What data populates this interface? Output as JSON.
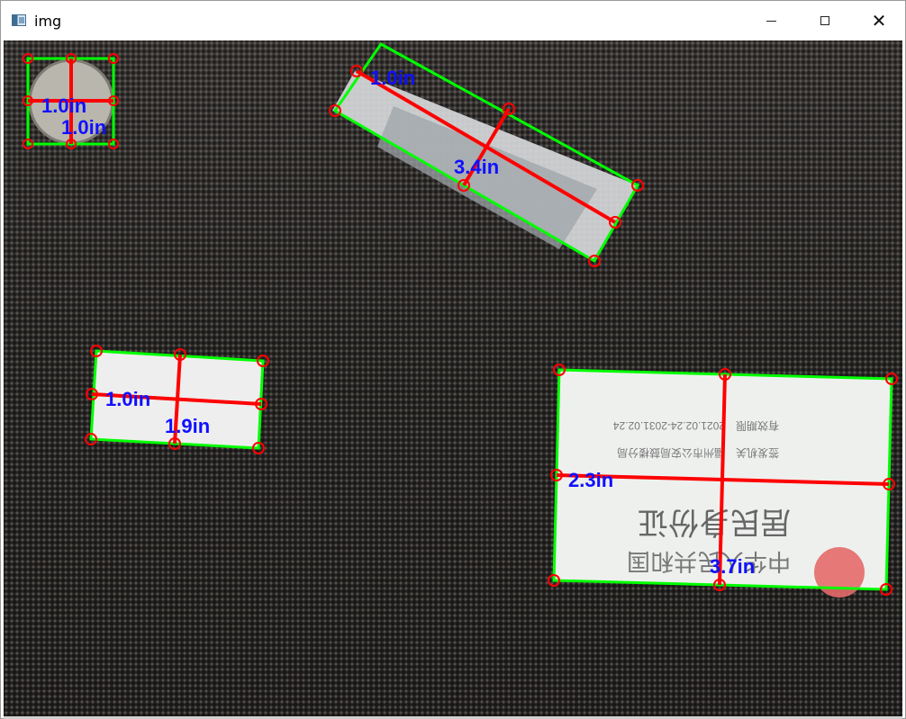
{
  "window": {
    "title": "img",
    "icon": "opencv-image-window-icon",
    "controls": {
      "minimize": "minimize-icon",
      "maximize": "maximize-icon",
      "close": "close-icon"
    }
  },
  "measurements": {
    "coin": {
      "label_a": "1.0in",
      "label_b": "1.0in"
    },
    "tube": {
      "label_a": "1.0in",
      "label_b": "3.4in"
    },
    "card": {
      "label_a": "1.0in",
      "label_b": "1.9in"
    },
    "id_card": {
      "label_a": "2.3in",
      "label_b": "3.7in"
    }
  },
  "id_card_text": {
    "line1": "中华人民共和国",
    "line2": "居民身份证",
    "line3": "签发机关",
    "line4": "福州市公安局鼓楼分局",
    "line5": "有效期限",
    "line6": "2021.02.24-2031.02.24"
  },
  "colors": {
    "box": "#00ff00",
    "axis": "#ff0000",
    "label": "#1010ff",
    "marker": "#ff0000"
  }
}
